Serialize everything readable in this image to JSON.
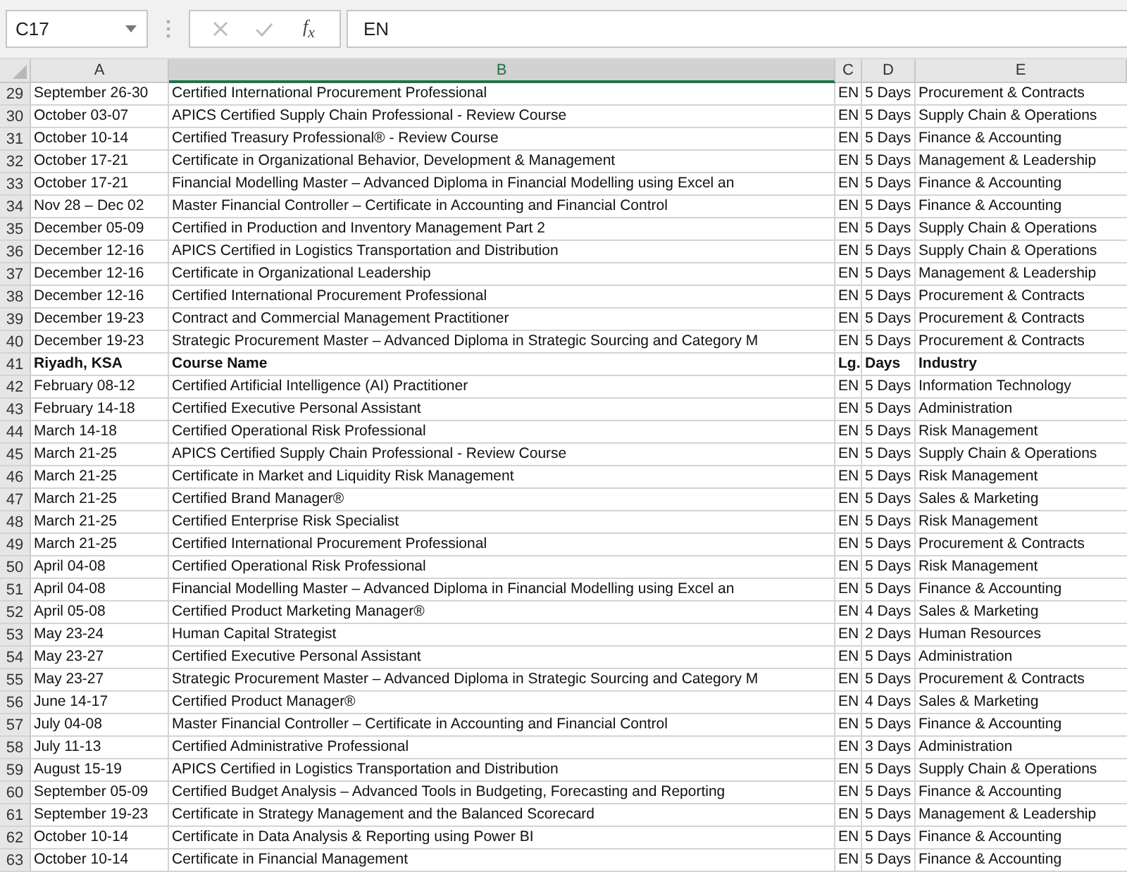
{
  "name_box": {
    "value": "C17"
  },
  "formula_bar": {
    "function_label": "f$_{x}$",
    "value": "EN"
  },
  "columns": [
    {
      "label": "A",
      "selected": false
    },
    {
      "label": "B",
      "selected": true
    },
    {
      "label": "C",
      "selected": false
    },
    {
      "label": "D",
      "selected": false
    },
    {
      "label": "E",
      "selected": false
    }
  ],
  "rows": [
    {
      "number": "29",
      "kind": "data",
      "cells": [
        "September 26-30",
        "Certified International Procurement Professional",
        "EN",
        "5 Days",
        "Procurement & Contracts"
      ]
    },
    {
      "number": "30",
      "kind": "data",
      "cells": [
        "October 03-07",
        "APICS Certified Supply Chain Professional - Review Course",
        "EN",
        "5 Days",
        "Supply Chain & Operations"
      ]
    },
    {
      "number": "31",
      "kind": "data",
      "cells": [
        "October 10-14",
        "Certified Treasury Professional® - Review Course",
        "EN",
        "5 Days",
        "Finance & Accounting"
      ]
    },
    {
      "number": "32",
      "kind": "data",
      "cells": [
        "October 17-21",
        "Certificate in Organizational Behavior, Development & Management",
        "EN",
        "5 Days",
        "Management & Leadership"
      ]
    },
    {
      "number": "33",
      "kind": "data",
      "cells": [
        "October 17-21",
        "Financial Modelling Master – Advanced Diploma in Financial Modelling using Excel an",
        "EN",
        "5 Days",
        "Finance & Accounting"
      ]
    },
    {
      "number": "34",
      "kind": "data",
      "cells": [
        "Nov 28 – Dec 02",
        "Master Financial Controller – Certificate in Accounting and Financial Control",
        "EN",
        "5 Days",
        "Finance & Accounting"
      ]
    },
    {
      "number": "35",
      "kind": "data",
      "cells": [
        "December 05-09",
        "Certified in Production and Inventory Management Part 2",
        "EN",
        "5 Days",
        "Supply Chain & Operations"
      ]
    },
    {
      "number": "36",
      "kind": "data",
      "cells": [
        "December 12-16",
        "APICS Certified in Logistics Transportation and Distribution",
        "EN",
        "5 Days",
        "Supply Chain & Operations"
      ]
    },
    {
      "number": "37",
      "kind": "data",
      "cells": [
        "December 12-16",
        "Certificate in Organizational Leadership",
        "EN",
        "5 Days",
        "Management & Leadership"
      ]
    },
    {
      "number": "38",
      "kind": "data",
      "cells": [
        "December 12-16",
        "Certified International Procurement Professional",
        "EN",
        "5 Days",
        "Procurement & Contracts"
      ]
    },
    {
      "number": "39",
      "kind": "data",
      "cells": [
        "December 19-23",
        "Contract and Commercial Management Practitioner",
        "EN",
        "5 Days",
        "Procurement & Contracts"
      ]
    },
    {
      "number": "40",
      "kind": "data",
      "cells": [
        "December 19-23",
        "Strategic Procurement Master – Advanced Diploma in Strategic Sourcing and Category M",
        "EN",
        "5 Days",
        "Procurement & Contracts"
      ]
    },
    {
      "number": "41",
      "kind": "heading",
      "cells": [
        "Riyadh, KSA",
        "Course Name",
        "Lg.",
        "Days",
        "Industry"
      ]
    },
    {
      "number": "42",
      "kind": "data",
      "cells": [
        "February 08-12",
        "Certified Artificial Intelligence (AI) Practitioner",
        "EN",
        "5 Days",
        "Information Technology"
      ]
    },
    {
      "number": "43",
      "kind": "data",
      "cells": [
        "February 14-18",
        "Certified Executive Personal Assistant",
        "EN",
        "5 Days",
        "Administration"
      ]
    },
    {
      "number": "44",
      "kind": "data",
      "cells": [
        "March 14-18",
        "Certified Operational Risk Professional",
        "EN",
        "5 Days",
        "Risk Management"
      ]
    },
    {
      "number": "45",
      "kind": "data",
      "cells": [
        "March 21-25",
        "APICS Certified Supply Chain Professional - Review Course",
        "EN",
        "5 Days",
        "Supply Chain & Operations"
      ]
    },
    {
      "number": "46",
      "kind": "data",
      "cells": [
        "March 21-25",
        "Certificate in Market and Liquidity Risk Management",
        "EN",
        "5 Days",
        "Risk Management"
      ]
    },
    {
      "number": "47",
      "kind": "data",
      "cells": [
        "March 21-25",
        "Certified Brand Manager®",
        "EN",
        "5 Days",
        "Sales & Marketing"
      ]
    },
    {
      "number": "48",
      "kind": "data",
      "cells": [
        "March 21-25",
        "Certified Enterprise Risk Specialist",
        "EN",
        "5 Days",
        "Risk Management"
      ]
    },
    {
      "number": "49",
      "kind": "data",
      "cells": [
        "March 21-25",
        "Certified International Procurement Professional",
        "EN",
        "5 Days",
        "Procurement & Contracts"
      ]
    },
    {
      "number": "50",
      "kind": "data",
      "cells": [
        "April 04-08",
        "Certified Operational Risk Professional",
        "EN",
        "5 Days",
        "Risk Management"
      ]
    },
    {
      "number": "51",
      "kind": "data",
      "cells": [
        "April 04-08",
        "Financial Modelling Master – Advanced Diploma in Financial Modelling using Excel an",
        "EN",
        "5 Days",
        "Finance & Accounting"
      ]
    },
    {
      "number": "52",
      "kind": "data",
      "cells": [
        "April 05-08",
        "Certified Product Marketing Manager®",
        "EN",
        "4 Days",
        "Sales & Marketing"
      ]
    },
    {
      "number": "53",
      "kind": "data",
      "cells": [
        "May 23-24",
        "Human Capital Strategist",
        "EN",
        "2 Days",
        "Human Resources"
      ]
    },
    {
      "number": "54",
      "kind": "data",
      "cells": [
        "May 23-27",
        "Certified Executive Personal Assistant",
        "EN",
        "5 Days",
        "Administration"
      ]
    },
    {
      "number": "55",
      "kind": "data",
      "cells": [
        "May 23-27",
        "Strategic Procurement Master – Advanced Diploma in Strategic Sourcing and Category M",
        "EN",
        "5 Days",
        "Procurement & Contracts"
      ]
    },
    {
      "number": "56",
      "kind": "data",
      "cells": [
        "June 14-17",
        "Certified Product Manager®",
        "EN",
        "4 Days",
        "Sales & Marketing"
      ]
    },
    {
      "number": "57",
      "kind": "data",
      "cells": [
        "July 04-08",
        "Master Financial Controller – Certificate in Accounting and Financial Control",
        "EN",
        "5 Days",
        "Finance & Accounting"
      ]
    },
    {
      "number": "58",
      "kind": "data",
      "cells": [
        "July 11-13",
        "Certified Administrative Professional",
        "EN",
        "3 Days",
        "Administration"
      ]
    },
    {
      "number": "59",
      "kind": "data",
      "cells": [
        "August 15-19",
        "APICS Certified in Logistics Transportation and Distribution",
        "EN",
        "5 Days",
        "Supply Chain & Operations"
      ]
    },
    {
      "number": "60",
      "kind": "data",
      "cells": [
        "September 05-09",
        "Certified Budget Analysis – Advanced Tools in Budgeting, Forecasting and Reporting",
        "EN",
        "5 Days",
        "Finance & Accounting"
      ]
    },
    {
      "number": "61",
      "kind": "data",
      "cells": [
        "September 19-23",
        "Certificate in Strategy Management and the Balanced Scorecard",
        "EN",
        "5 Days",
        "Management & Leadership"
      ]
    },
    {
      "number": "62",
      "kind": "data",
      "cells": [
        "October 10-14",
        "Certificate in Data Analysis & Reporting using Power BI",
        "EN",
        "5 Days",
        "Finance & Accounting"
      ]
    },
    {
      "number": "63",
      "kind": "data",
      "cells": [
        "October 10-14",
        "Certificate in Financial Management",
        "EN",
        "5 Days",
        "Finance & Accounting"
      ]
    }
  ]
}
